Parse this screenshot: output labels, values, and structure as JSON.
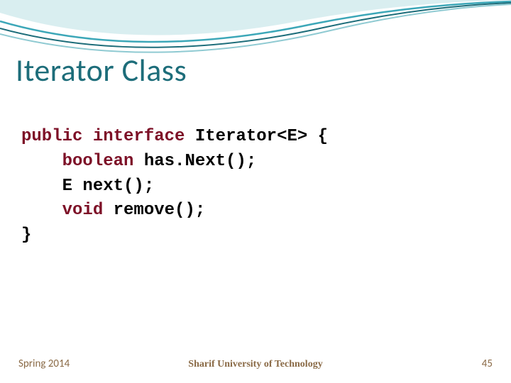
{
  "title": "Iterator Class",
  "code": {
    "kw_public": "public",
    "kw_interface": "interface",
    "decl_tail": " Iterator<E> {",
    "indent": "    ",
    "kw_boolean": "boolean",
    "hasnext_tail": " has.Next();",
    "next_line": "E next();",
    "kw_void": "void",
    "remove_tail": " remove();",
    "close": "}"
  },
  "footer": {
    "left": "Spring 2014",
    "center": "Sharif University of Technology",
    "right": "45"
  }
}
